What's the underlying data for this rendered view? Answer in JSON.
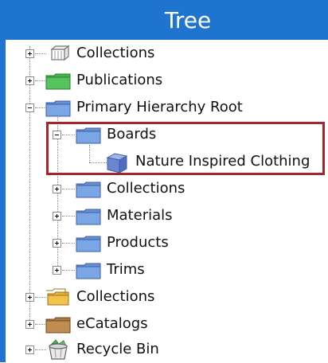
{
  "panel": {
    "title": "Tree"
  },
  "tree": {
    "items": [
      {
        "label": "Collections",
        "icon": "collection-outline-icon",
        "state": "collapsed"
      },
      {
        "label": "Publications",
        "icon": "green-folder-icon",
        "state": "collapsed"
      },
      {
        "label": "Primary Hierarchy Root",
        "icon": "blue-folder-icon",
        "state": "expanded",
        "children": [
          {
            "label": "Boards",
            "icon": "blue-folder-icon",
            "state": "expanded",
            "selected": true,
            "children": [
              {
                "label": "Nature Inspired Clothing",
                "icon": "blue-cube-icon"
              }
            ]
          },
          {
            "label": "Collections",
            "icon": "blue-folder-icon",
            "state": "collapsed"
          },
          {
            "label": "Materials",
            "icon": "blue-folder-icon",
            "state": "collapsed"
          },
          {
            "label": "Products",
            "icon": "blue-folder-icon",
            "state": "collapsed"
          },
          {
            "label": "Trims",
            "icon": "blue-folder-icon",
            "state": "collapsed"
          }
        ]
      },
      {
        "label": "Collections",
        "icon": "yellow-folder-stack-icon",
        "state": "collapsed"
      },
      {
        "label": "eCatalogs",
        "icon": "brown-folder-icon",
        "state": "collapsed"
      },
      {
        "label": "Recycle Bin",
        "icon": "recycle-bin-icon",
        "state": "collapsed"
      }
    ]
  },
  "colors": {
    "title_bar": "#1f74cf",
    "selection_border": "#a4262c",
    "blue_folder": "#7a9ad6",
    "green_folder": "#46b44c",
    "brown_folder": "#b8874a",
    "yellow_folder": "#f2c24a"
  }
}
